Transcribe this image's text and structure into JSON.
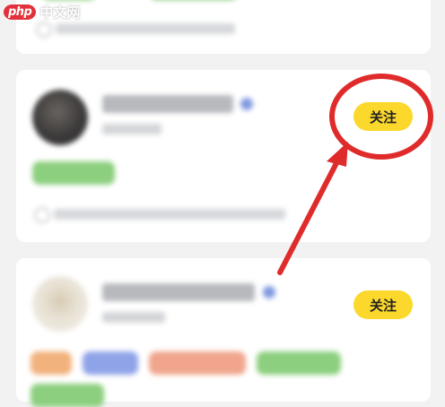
{
  "watermark": {
    "badge": "php",
    "text": "中文网"
  },
  "cards": [
    {
      "follow_label": "关注"
    },
    {
      "follow_label": "关注"
    }
  ],
  "colors": {
    "follow_button": "#fbd82b",
    "annotation_red": "#e02b2b",
    "tag_green": "#8ccf7e",
    "tag_orange": "#f2b27d",
    "tag_blue": "#8fa3e8",
    "tag_salmon": "#f0a58c",
    "verified_badge": "#7f98df"
  },
  "annotation": {
    "shape": "circle-and-arrow",
    "target": "follow-button"
  }
}
